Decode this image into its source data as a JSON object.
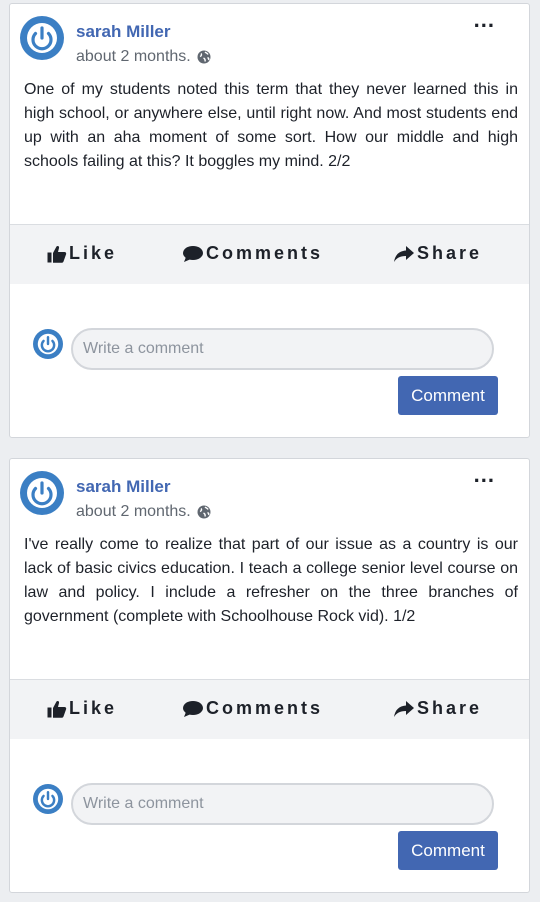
{
  "posts": [
    {
      "author": "sarah Miller",
      "time": "about 2 months.",
      "text": "One of my students noted this term that they never learned this in high school, or anywhere else, until right now. And most students end up with an aha moment of some sort. How our middle and high schools failing at this? It boggles my mind. 2/2",
      "actions": {
        "like": "Like",
        "comments": "Comments",
        "share": "Share"
      },
      "comment_placeholder": "Write a comment",
      "comment_button": "Comment"
    },
    {
      "author": "sarah Miller",
      "time": "about 2 months.",
      "text": "I've really come to realize that part of our issue as a country is our lack of basic civics education. I teach a college senior level course on law and policy. I include a refresher on the three branches of government (complete with Schoolhouse Rock vid). 1/2",
      "actions": {
        "like": "Like",
        "comments": "Comments",
        "share": "Share"
      },
      "comment_placeholder": "Write a comment",
      "comment_button": "Comment"
    }
  ],
  "more_glyph": "...",
  "colors": {
    "brand": "#4267b2",
    "avatar": "#3b7fc4",
    "action_bar": "#f2f3f5"
  },
  "icons": [
    "power-avatar-icon",
    "globe-icon",
    "more-options-icon",
    "thumbs-up-icon",
    "comment-bubble-icon",
    "share-arrow-icon"
  ]
}
